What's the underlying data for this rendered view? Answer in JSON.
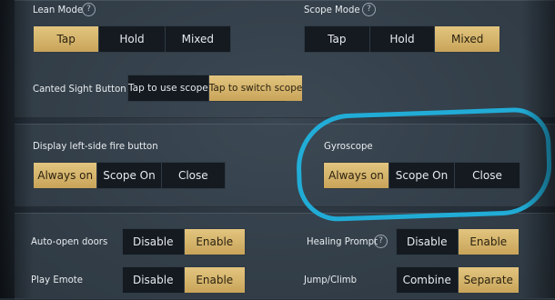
{
  "lean_mode": {
    "label": "Lean Mode",
    "help": "?",
    "options": [
      "Tap",
      "Hold",
      "Mixed"
    ],
    "selected": "Tap"
  },
  "scope_mode": {
    "label": "Scope Mode",
    "help": "?",
    "options": [
      "Tap",
      "Hold",
      "Mixed"
    ],
    "selected": "Mixed"
  },
  "canted_sight": {
    "label": "Canted Sight Button",
    "options": [
      "Tap to use scope",
      "Tap to switch scope"
    ],
    "selected": "Tap to switch scope"
  },
  "left_fire": {
    "label": "Display left-side fire button",
    "options": [
      "Always on",
      "Scope On",
      "Close"
    ],
    "selected": "Always on"
  },
  "gyroscope": {
    "label": "Gyroscope",
    "options": [
      "Always on",
      "Scope On",
      "Close"
    ],
    "selected": "Always on"
  },
  "auto_open_doors": {
    "label": "Auto-open doors",
    "options": [
      "Disable",
      "Enable"
    ],
    "selected": "Enable"
  },
  "healing_prompt": {
    "label": "Healing Prompt",
    "help": "?",
    "options": [
      "Disable",
      "Enable"
    ],
    "selected": "Enable"
  },
  "play_emote": {
    "label": "Play Emote",
    "options": [
      "Disable",
      "Enable"
    ],
    "selected": "Enable"
  },
  "jump_climb": {
    "label": "Jump/Climb",
    "options": [
      "Combine",
      "Separate"
    ],
    "selected": "Separate"
  },
  "colors": {
    "accent_gold": "#d4b46a",
    "annotation_blue": "#1fb8e6"
  }
}
